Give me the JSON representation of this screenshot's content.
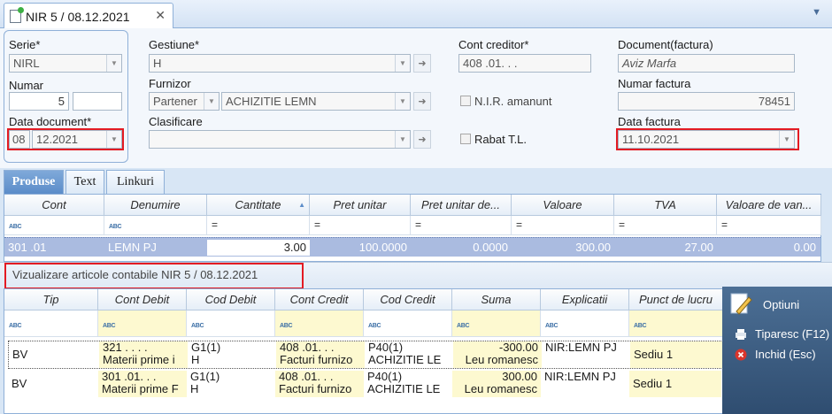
{
  "tab": {
    "title": "NIR 5 / 08.12.2021",
    "close": "✕",
    "menu": "▼"
  },
  "form": {
    "serie_label": "Serie*",
    "serie_value": "NIRL",
    "numar_label": "Numar",
    "numar_value": "5",
    "data_doc_label": "Data document*",
    "data_doc_day": "08",
    "data_doc_rest": "12.2021",
    "gestiune_label": "Gestiune*",
    "gestiune_value": "H",
    "furnizor_label": "Furnizor",
    "furnizor_type": "Partener",
    "furnizor_value": "ACHIZITIE LEMN",
    "clasificare_label": "Clasificare",
    "clasificare_value": "",
    "cont_creditor_label": "Cont creditor*",
    "cont_creditor_value": "408 .01.   .   .",
    "nir_amanunt_label": "N.I.R. amanunt",
    "rabat_label": "Rabat  T.L.",
    "document_label": "Document(factura)",
    "document_value": "Aviz Marfa",
    "numar_factura_label": "Numar factura",
    "numar_factura_value": "78451",
    "data_factura_label": "Data factura",
    "data_factura_value": "11.10.2021"
  },
  "subtabs": [
    "Produse",
    "Text",
    "Linkuri"
  ],
  "produse_grid": {
    "headers": [
      "Cont",
      "Denumire",
      "Cantitate",
      "Pret unitar",
      "Pret unitar de...",
      "Valoare",
      "TVA",
      "Valoare de van..."
    ],
    "sort_indicator": "▲",
    "filter_eq": "=",
    "row": [
      "301 .01",
      "LEMN PJ",
      "3.00",
      "100.0000",
      "0.0000",
      "300.00",
      "27.00",
      "0.00"
    ]
  },
  "articole": {
    "title": "Vizualizare articole contabile NIR 5 / 08.12.2021",
    "headers": [
      "Tip",
      "Cont Debit",
      "Cod Debit",
      "Cont Credit",
      "Cod Credit",
      "Suma",
      "Explicatii",
      "Punct de lucru"
    ],
    "rows": [
      {
        "tip": "BV",
        "cont_debit": "321 .   .   .   .",
        "cont_debit_desc": "Materii prime i",
        "cod_debit": "G1(1)",
        "cod_debit_desc": "H",
        "cont_credit": "408 .01.   .   .",
        "cont_credit_desc": "Facturi furnizo",
        "cod_credit": "P40(1)",
        "cod_credit_desc": "ACHIZITIE LE",
        "suma": "-300.00",
        "suma_desc": "Leu romanesc",
        "explicatii": "NIR:LEMN PJ",
        "punct": "Sediu 1"
      },
      {
        "tip": "BV",
        "cont_debit": "301 .01.   .   .",
        "cont_debit_desc": "Materii prime F",
        "cod_debit": "G1(1)",
        "cod_debit_desc": "H",
        "cont_credit": "408 .01.   .   .",
        "cont_credit_desc": "Facturi furnizo",
        "cod_credit": "P40(1)",
        "cod_credit_desc": "ACHIZITIE LE",
        "suma": "300.00",
        "suma_desc": "Leu romanesc",
        "explicatii": "NIR:LEMN PJ",
        "punct": "Sediu 1"
      }
    ]
  },
  "actions": {
    "optiuni": "Optiuni",
    "tiparesc": "Tiparesc (F12)",
    "inchid": "Inchid (Esc)"
  },
  "icons": {
    "abc": "ABC",
    "arrow": "➜",
    "dropdown": "▼"
  },
  "colors": {
    "accent": "#5b8cc9",
    "highlight_row": "#aabbe0",
    "red_marker": "#e31b23",
    "yellow_cell": "#fdf9d0"
  }
}
